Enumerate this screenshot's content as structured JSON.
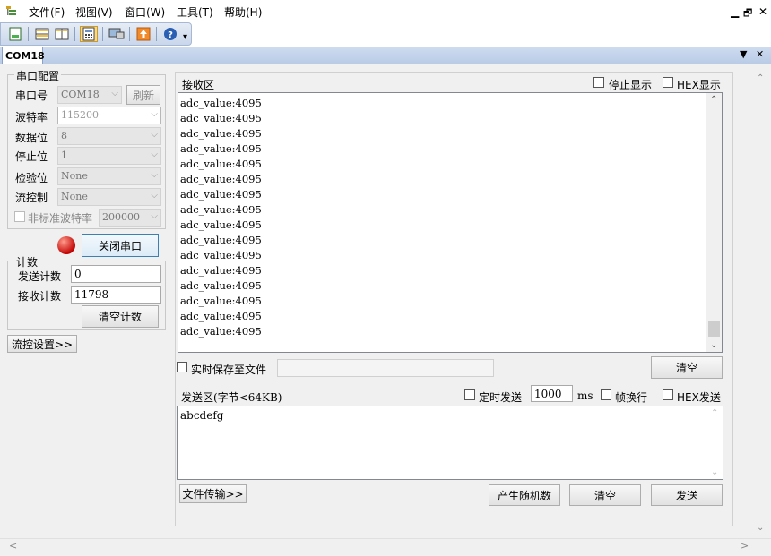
{
  "menubar": {
    "items": [
      "文件(F)",
      "视图(V)",
      "窗口(W)",
      "工具(T)",
      "帮助(H)"
    ],
    "controls": [
      "▁",
      "🗗",
      "✕"
    ]
  },
  "toolbar": {
    "icons": [
      "new-doc-icon",
      "split-horizontal-icon",
      "split-vertical-icon",
      "calculator-icon",
      "monitor-icon",
      "upload-icon",
      "help-icon"
    ],
    "overflow": "▾"
  },
  "tabs": {
    "active": "COM18",
    "controls": [
      "▼",
      "✕"
    ]
  },
  "serial_config": {
    "legend": "串口配置",
    "port_label": "串口号",
    "port_value": "COM18",
    "refresh_label": "刷新",
    "baud_label": "波特率",
    "baud_value": "115200",
    "databits_label": "数据位",
    "databits_value": "8",
    "stopbits_label": "停止位",
    "stopbits_value": "1",
    "parity_label": "检验位",
    "parity_value": "None",
    "flow_label": "流控制",
    "flow_value": "None",
    "nonstd_label": "非标准波特率",
    "nonstd_value": "200000",
    "close_port_label": "关闭串口",
    "status_color": "#e02020"
  },
  "counter": {
    "legend": "计数",
    "sent_label": "发送计数",
    "sent_value": "0",
    "recv_label": "接收计数",
    "recv_value": "11798",
    "clear_label": "清空计数"
  },
  "flow_settings_label": "流控设置>>",
  "receive": {
    "title": "接收区",
    "stop_display_label": "停止显示",
    "hex_display_label": "HEX显示",
    "lines": [
      "adc_value:4095",
      "adc_value:4095",
      "adc_value:4095",
      "adc_value:4095",
      "adc_value:4095",
      "adc_value:4095",
      "adc_value:4095",
      "adc_value:4095",
      "adc_value:4095",
      "adc_value:4095",
      "adc_value:4095",
      "adc_value:4095",
      "adc_value:4095",
      "adc_value:4095",
      "adc_value:4095",
      "adc_value:4095"
    ],
    "save_label": "实时保存至文件",
    "clear_label": "清空"
  },
  "send": {
    "title": "发送区(字节<64KB)",
    "timed_label": "定时发送",
    "interval_value": "1000",
    "interval_unit": "ms",
    "newline_label": "帧换行",
    "hex_send_label": "HEX发送",
    "text": "abcdefg",
    "file_transfer_label": "文件传输>>",
    "random_label": "产生随机数",
    "clear_label": "清空",
    "send_label": "发送"
  },
  "colors": {
    "accent": "#3c7fb1",
    "title_bar": "#d6e2f3"
  }
}
